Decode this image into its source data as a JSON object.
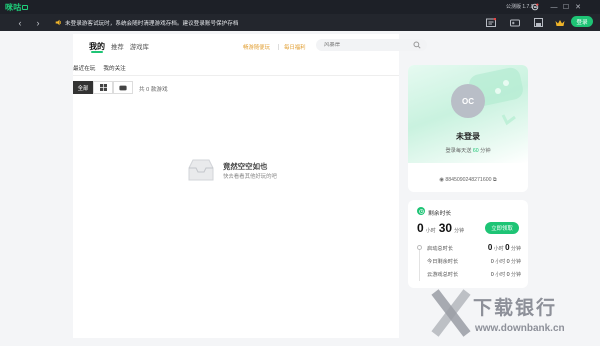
{
  "app": {
    "logo_text": "咪咕",
    "version": "公测版 1.7.0.1"
  },
  "titlebar": {
    "minimize": "—",
    "maximize": "☐",
    "close": "✕"
  },
  "nav": {
    "back": "‹",
    "forward": "›"
  },
  "notice": {
    "text": "未登录游客试玩时，系统会随时清理游戏存档。建议登录账号保护存档"
  },
  "top_actions": {
    "login_label": "登录"
  },
  "tabs": [
    {
      "label": "我的"
    },
    {
      "label": "推荐"
    },
    {
      "label": "游戏库"
    }
  ],
  "promos": [
    {
      "label": "畅游随便玩"
    },
    {
      "label": "每日福利"
    }
  ],
  "search": {
    "placeholder": "风暴岸"
  },
  "subtabs": [
    {
      "label": "最近在玩"
    },
    {
      "label": "我的关注"
    }
  ],
  "filters": [
    {
      "label": "全部"
    },
    {
      "label": "⊞"
    },
    {
      "label": "🎮"
    }
  ],
  "game_count": "共 0 款游戏",
  "empty_state": {
    "title": "竟然空空如也",
    "subtitle": "快去看看其他好玩的吧"
  },
  "profile": {
    "avatar_label": "OC",
    "name": "未登录",
    "desc_prefix": "登录每天送",
    "desc_minutes": "60",
    "desc_suffix": "分钟",
    "uid": "8845090248271600"
  },
  "time": {
    "title": "剩余时长",
    "hours": "0",
    "hours_unit": "小时",
    "minutes": "30",
    "minutes_unit": "分钟",
    "recharge_label": "立即领取",
    "rows": [
      {
        "label": "启动总时长",
        "h": "0",
        "hu": "小时",
        "m": "0",
        "mu": "分钟"
      },
      {
        "label": "今日剩余时长",
        "h": "0",
        "hu": "小时",
        "m": "0",
        "mu": "分钟"
      },
      {
        "label": "云游戏总时长",
        "h": "0",
        "hu": "小时",
        "m": "0",
        "mu": "分钟"
      }
    ]
  },
  "watermark": {
    "text": "下载银行",
    "url": "www.downbank.cn"
  },
  "colors": {
    "accent": "#1ec475",
    "promo": "#e2a035",
    "titlebar": "#1d2027"
  }
}
